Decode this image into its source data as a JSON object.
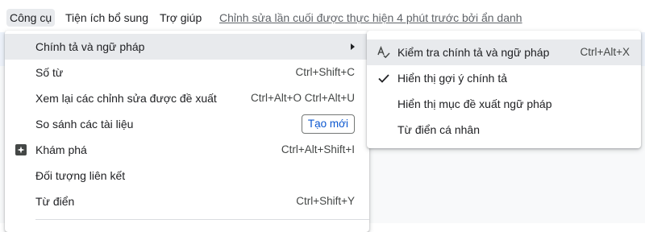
{
  "menubar": {
    "tools": "Công cụ",
    "extensions": "Tiện ích bổ sung",
    "help": "Trợ giúp",
    "last_edit": "Chỉnh sửa lần cuối được thực hiện 4 phút trước bởi ẩn danh"
  },
  "menu": {
    "items": [
      {
        "label": "Chính tả và ngữ pháp",
        "has_submenu": true
      },
      {
        "label": "Số từ",
        "shortcut": "Ctrl+Shift+C"
      },
      {
        "label": "Xem lại các chỉnh sửa được đề xuất",
        "shortcut": "Ctrl+Alt+O Ctrl+Alt+U"
      },
      {
        "label": "So sánh các tài liệu",
        "badge": "Tạo mới"
      },
      {
        "label": "Khám phá",
        "shortcut": "Ctrl+Alt+Shift+I",
        "icon": "explore-icon"
      },
      {
        "label": "Đối tượng liên kết"
      },
      {
        "label": "Từ điển",
        "shortcut": "Ctrl+Shift+Y"
      }
    ]
  },
  "submenu": {
    "items": [
      {
        "label": "Kiểm tra chính tả và ngữ pháp",
        "shortcut": "Ctrl+Alt+X",
        "icon": "spellcheck-icon"
      },
      {
        "label": "Hiển thị gợi ý chính tả",
        "checked": true,
        "icon": "check-icon"
      },
      {
        "label": "Hiển thị mục đề xuất ngữ pháp",
        "checked": false
      },
      {
        "label": "Từ điển cá nhân"
      }
    ]
  },
  "colors": {
    "menu_highlight": "#e8eaed",
    "badge_text": "#0b57d0",
    "text": "#202124"
  }
}
